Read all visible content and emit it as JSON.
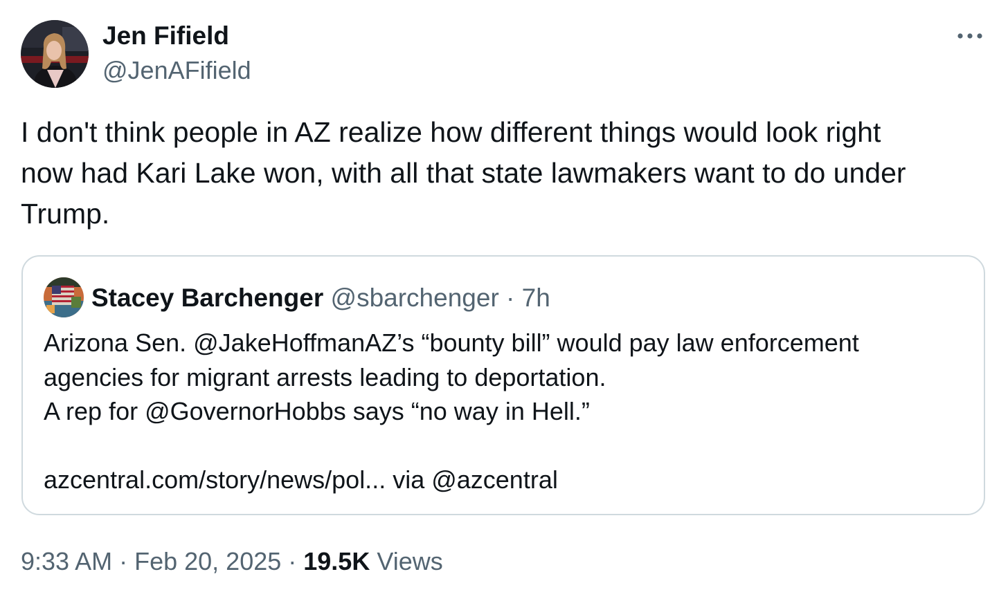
{
  "author": {
    "name": "Jen Fifield",
    "handle": "@JenAFifield"
  },
  "tweet": {
    "text": "I don't think people in AZ realize how different things would look right\nnow had Kari Lake won, with all that state lawmakers want to do under\nTrump."
  },
  "quote": {
    "name": "Stacey Barchenger",
    "handle": "@sbarchenger",
    "separator": " · ",
    "age": "7h",
    "text": "Arizona Sen. @JakeHoffmanAZ’s “bounty bill” would pay law enforcement\nagencies for migrant arrests leading to deportation.\nA rep for @GovernorHobbs says “no way in Hell.”\n\nazcentral.com/story/news/pol... via @azcentral"
  },
  "meta": {
    "time": "9:33 AM",
    "separator": " · ",
    "date": "Feb 20, 2025",
    "views_count": "19.5K",
    "views_label": "Views"
  },
  "icons": {
    "more": "more-horizontal-icon"
  },
  "colors": {
    "text_primary": "#0f1419",
    "text_secondary": "#536471",
    "border": "#cfd9de"
  }
}
